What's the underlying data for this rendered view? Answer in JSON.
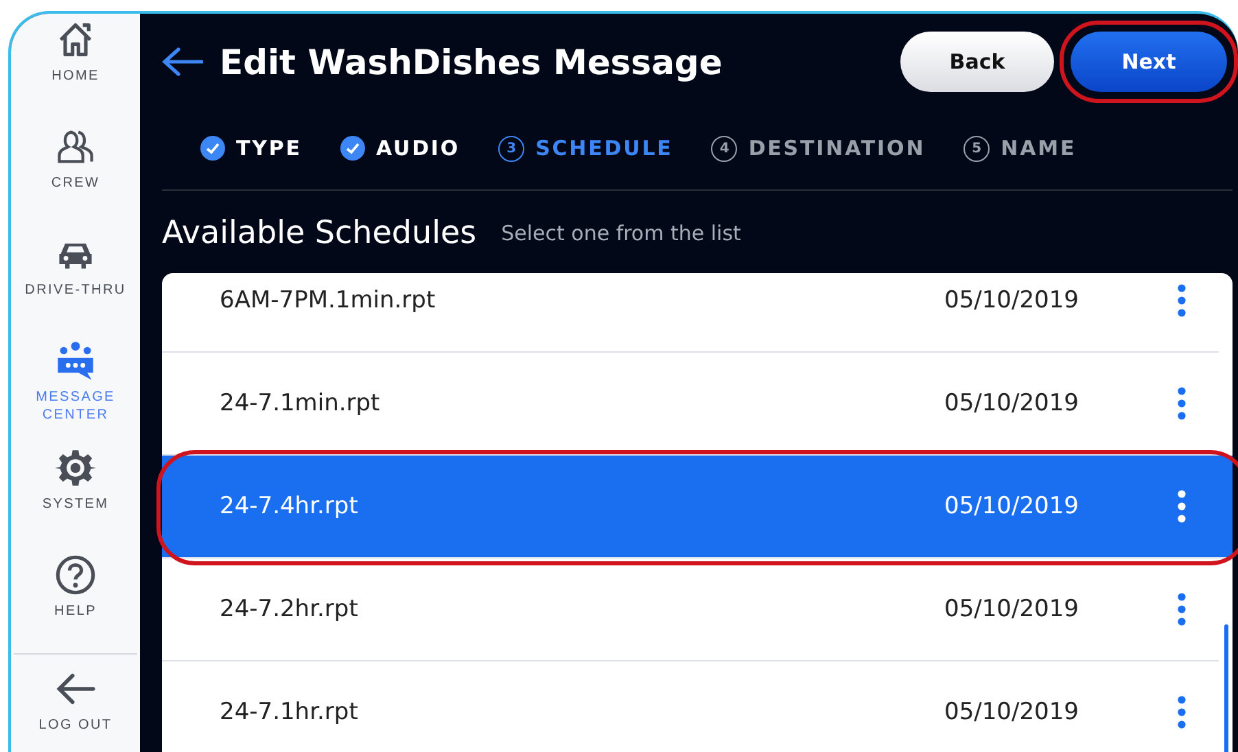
{
  "sidebar": {
    "items": [
      {
        "label": "HOME",
        "selected": false
      },
      {
        "label": "CREW",
        "selected": false
      },
      {
        "label": "DRIVE-THRU",
        "selected": false
      },
      {
        "label": "MESSAGE CENTER",
        "selected": true
      },
      {
        "label": "SYSTEM",
        "selected": false
      },
      {
        "label": "HELP",
        "selected": false
      }
    ],
    "footer": {
      "label": "LOG OUT"
    }
  },
  "header": {
    "title": "Edit WashDishes Message",
    "buttons": [
      {
        "label": "Back",
        "kind": "secondary",
        "highlighted": false
      },
      {
        "label": "Next",
        "kind": "primary",
        "highlighted": true
      }
    ]
  },
  "steps": [
    {
      "label": "TYPE",
      "kind": "done"
    },
    {
      "label": "AUDIO",
      "kind": "done"
    },
    {
      "label": "SCHEDULE",
      "kind": "current",
      "number": "3"
    },
    {
      "label": "DESTINATION",
      "kind": "pending",
      "number": "4"
    },
    {
      "label": "NAME",
      "kind": "pending",
      "number": "5"
    }
  ],
  "section": {
    "title": "Available Schedules",
    "hint": "Select one from the list"
  },
  "schedules": [
    {
      "name": "6AM-7PM.1min.rpt",
      "date": "05/10/2019",
      "selected": false,
      "highlighted": false
    },
    {
      "name": "24-7.1min.rpt",
      "date": "05/10/2019",
      "selected": false,
      "highlighted": false
    },
    {
      "name": "24-7.4hr.rpt",
      "date": "05/10/2019",
      "selected": true,
      "highlighted": true
    },
    {
      "name": "24-7.2hr.rpt",
      "date": "05/10/2019",
      "selected": false,
      "highlighted": false
    },
    {
      "name": "24-7.1hr.rpt",
      "date": "05/10/2019",
      "selected": false,
      "highlighted": false
    }
  ]
}
